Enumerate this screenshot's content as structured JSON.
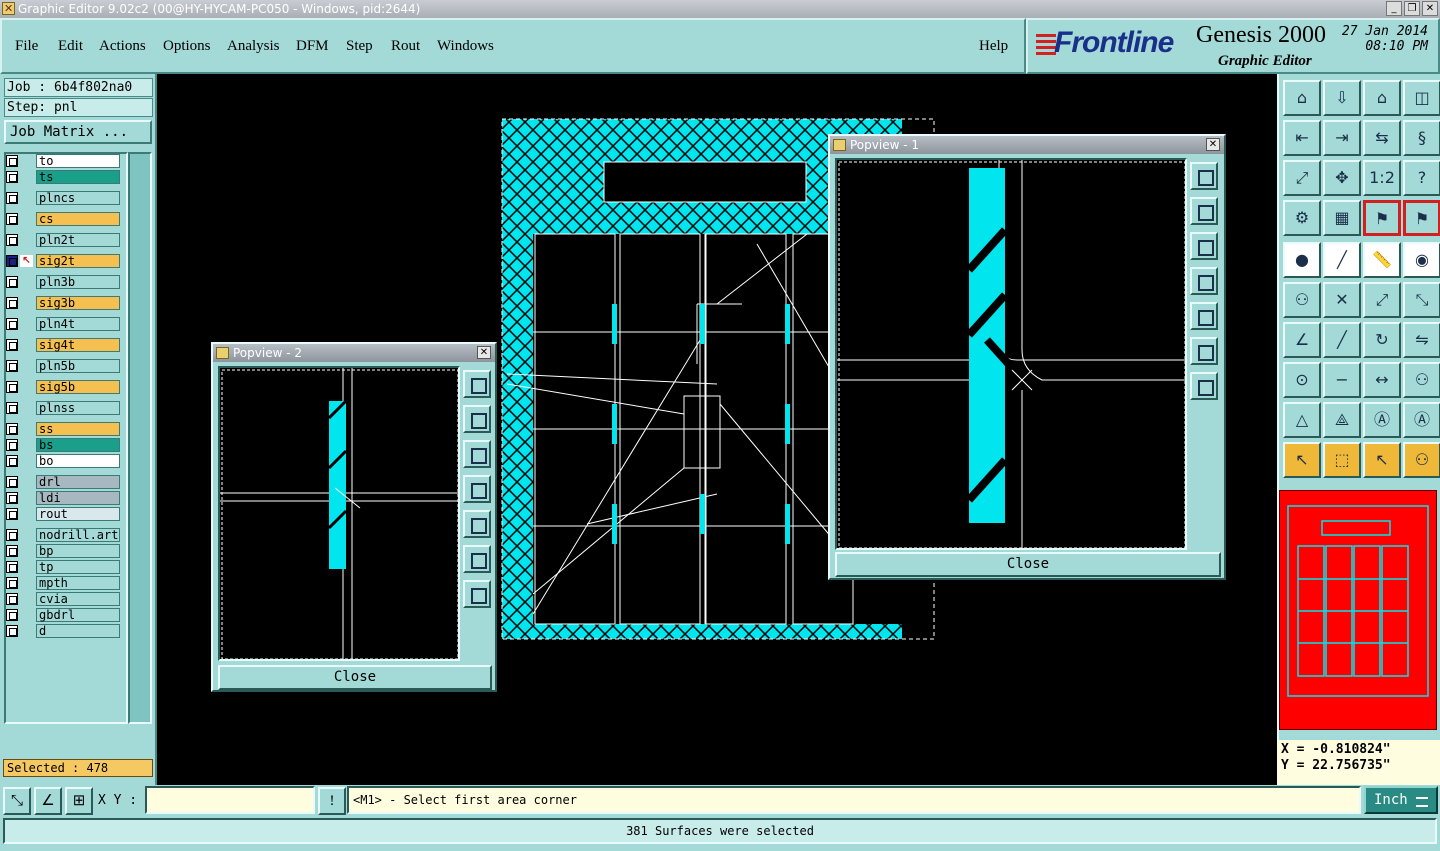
{
  "window": {
    "title": "Graphic Editor 9.02c2 (00@HY-HYCAM-PC050 - Windows, pid:2644)",
    "controls": [
      "_",
      "❐",
      "✕"
    ]
  },
  "menu": [
    "File",
    "Edit",
    "Actions",
    "Options",
    "Analysis",
    "DFM",
    "Step",
    "Rout",
    "Windows"
  ],
  "help": "Help",
  "brand": {
    "logo": "Frontline",
    "product": "Genesis 2000",
    "subtitle": "Graphic Editor",
    "date": "27 Jan 2014",
    "time": "08:10 PM"
  },
  "job": {
    "job_line": "Job : 6b4f802na0",
    "step_line": "Step: pnl",
    "matrix_button": "Job Matrix ..."
  },
  "layers": [
    {
      "name": "to",
      "color": "#ffffff"
    },
    {
      "name": "ts",
      "color": "#1aa08a"
    },
    {
      "name": "plncs",
      "color": "#a3d9d6"
    },
    {
      "name": "cs",
      "color": "#f5c050"
    },
    {
      "name": "pln2t",
      "color": "#a3d9d6"
    },
    {
      "name": "sig2t",
      "color": "#f5c050",
      "active": true
    },
    {
      "name": "pln3b",
      "color": "#a3d9d6"
    },
    {
      "name": "sig3b",
      "color": "#f5c050"
    },
    {
      "name": "pln4t",
      "color": "#a3d9d6"
    },
    {
      "name": "sig4t",
      "color": "#f5c050"
    },
    {
      "name": "pln5b",
      "color": "#a3d9d6"
    },
    {
      "name": "sig5b",
      "color": "#f5c050"
    },
    {
      "name": "plnss",
      "color": "#a3d9d6"
    },
    {
      "name": "ss",
      "color": "#f5c050"
    },
    {
      "name": "bs",
      "color": "#1aa08a"
    },
    {
      "name": "bo",
      "color": "#ffffff"
    },
    {
      "name": "drl",
      "color": "#a8b8c0"
    },
    {
      "name": "ldi",
      "color": "#a8b8c0"
    },
    {
      "name": "rout",
      "color": "#d8e8ec"
    },
    {
      "name": "nodrill.art",
      "color": "#a3d9d6"
    },
    {
      "name": "bp",
      "color": "#a3d9d6"
    },
    {
      "name": "tp",
      "color": "#a3d9d6"
    },
    {
      "name": "mpth",
      "color": "#a3d9d6"
    },
    {
      "name": "cvia",
      "color": "#a3d9d6"
    },
    {
      "name": "gbdrl",
      "color": "#a3d9d6"
    },
    {
      "name": "d",
      "color": "#a3d9d6"
    }
  ],
  "selected_count": "Selected : 478",
  "popview1": {
    "title": "Popview - 1",
    "close": "Close"
  },
  "popview2": {
    "title": "Popview - 2",
    "close": "Close"
  },
  "coords": {
    "x": "X = -0.810824\"",
    "y": "Y = 22.756735\""
  },
  "bottom": {
    "xy_label": "X Y :",
    "xy_value": "",
    "bang": "!",
    "prompt": "<M1> - Select first area corner",
    "unit": "Inch",
    "status": "381 Surfaces were selected"
  },
  "colors": {
    "panel": "#a3d9d6",
    "copper": "#00e5ee",
    "minimap": "#ff0000"
  }
}
